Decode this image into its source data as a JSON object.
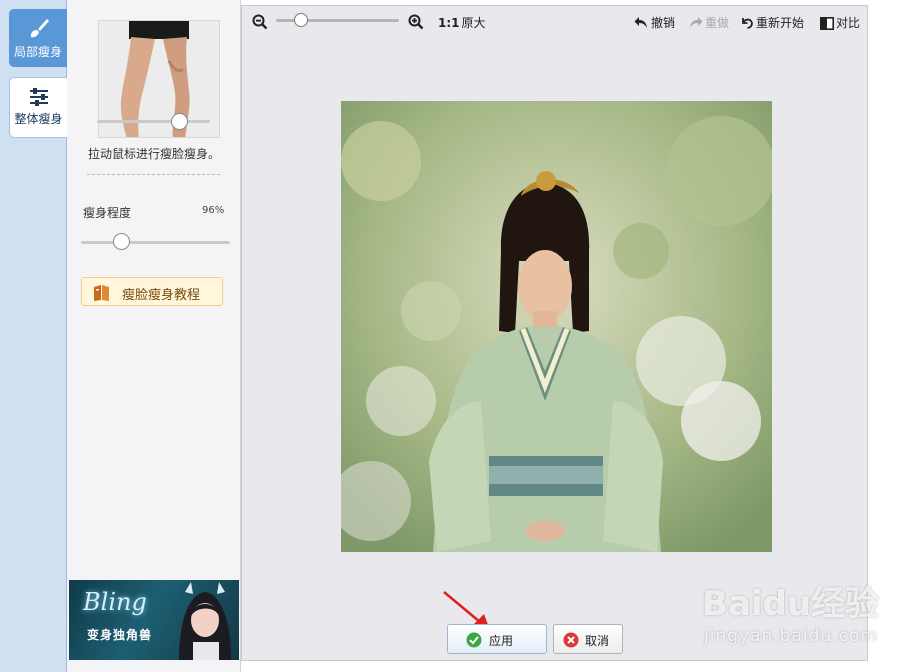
{
  "left_tabs": [
    {
      "label": "局部瘦身",
      "icon": "brush-icon",
      "active": true
    },
    {
      "label": "整体瘦身",
      "icon": "sliders-icon",
      "active": false
    }
  ],
  "panel": {
    "preview_image": "legs-preview",
    "hint": "拉动鼠标进行瘦脸瘦身。",
    "degree_label": "瘦身程度",
    "degree_value": "96%",
    "degree_level": 0.27,
    "tutorial_label": "瘦脸瘦身教程",
    "banner": {
      "title": "Bling",
      "subtitle": "变身独角兽"
    }
  },
  "toolbar": {
    "zoom_level": 0.2,
    "ratio": "1:1",
    "original_size": "原大",
    "undo": "撤销",
    "redo": "重做",
    "restart": "重新开始",
    "compare": "对比"
  },
  "photo": {
    "subject": "woman-in-hanfu-photo"
  },
  "actions": {
    "apply": "应用",
    "cancel": "取消"
  },
  "watermark": {
    "logo": "Baidu经验",
    "url": "jingyan.baidu.com"
  },
  "colors": {
    "active_tab": "#5a97d6",
    "tab_strip": "#cfe0f3",
    "apply_check": "#3aa845",
    "cancel_x": "#d93a3a",
    "arrow": "#e02020"
  }
}
